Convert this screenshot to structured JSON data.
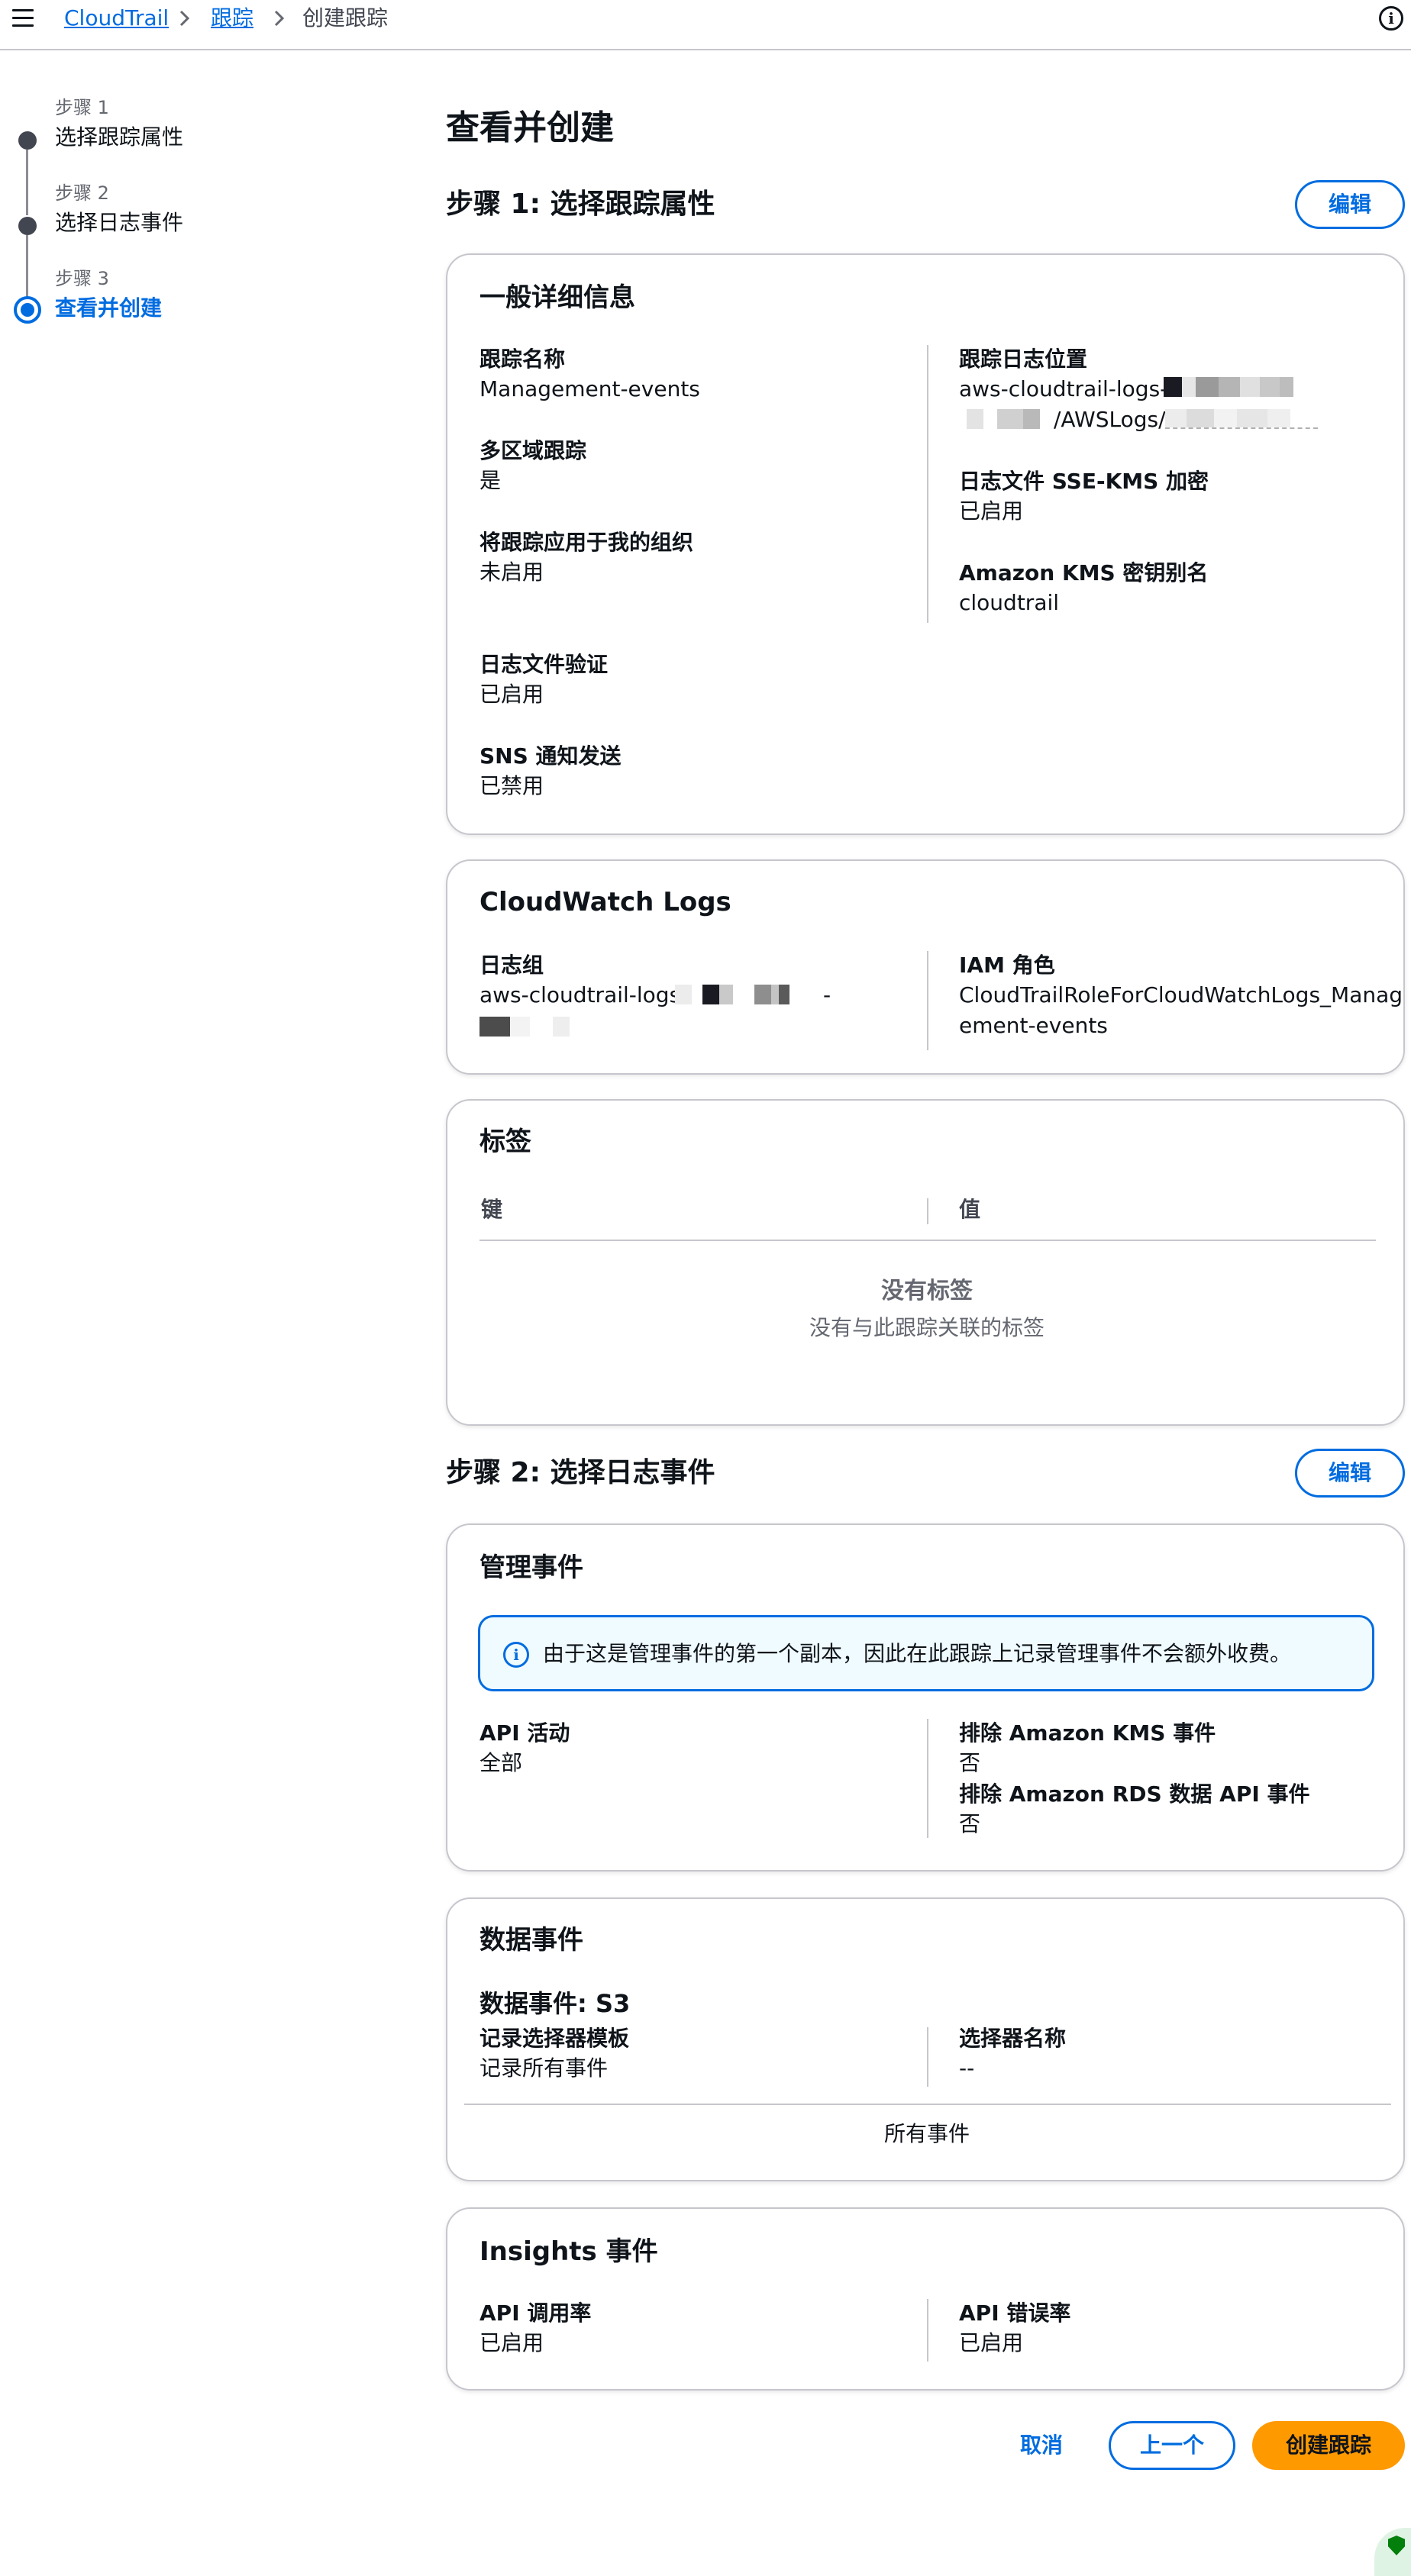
{
  "breadcrumb": {
    "items": [
      "CloudTrail",
      "跟踪"
    ],
    "current": "创建跟踪"
  },
  "steps": [
    {
      "num": "步骤 1",
      "name": "选择跟踪属性"
    },
    {
      "num": "步骤 2",
      "name": "选择日志事件"
    },
    {
      "num": "步骤 3",
      "name": "查看并创建"
    }
  ],
  "page_title": "查看并创建",
  "edit_label": "编辑",
  "step1": {
    "heading": "步骤 1: 选择跟踪属性",
    "general": {
      "title": "一般详细信息",
      "trail_name_label": "跟踪名称",
      "trail_name": "Management-events",
      "multi_region_label": "多区域跟踪",
      "multi_region": "是",
      "org_label": "将跟踪应用于我的组织",
      "org": "未启用",
      "log_location_label": "跟踪日志位置",
      "log_location_line1": "aws-cloudtrail-logs-",
      "log_location_line2": "/AWSLogs/",
      "sse_label": "日志文件 SSE-KMS 加密",
      "sse": "已启用",
      "kms_alias_label": "Amazon KMS 密钥别名",
      "kms_alias": "cloudtrail",
      "validation_label": "日志文件验证",
      "validation": "已启用",
      "sns_label": "SNS 通知发送",
      "sns": "已禁用"
    },
    "cloudwatch": {
      "title": "CloudWatch Logs",
      "log_group_label": "日志组",
      "log_group": "aws-cloudtrail-logs-",
      "log_group_suffix": "-",
      "iam_label": "IAM 角色",
      "iam_line1": "CloudTrailRoleForCloudWatchLogs_Manag",
      "iam_line2": "ement-events"
    },
    "tags": {
      "title": "标签",
      "col_key": "键",
      "col_value": "值",
      "empty_title": "没有标签",
      "empty_sub": "没有与此跟踪关联的标签"
    }
  },
  "step2": {
    "heading": "步骤 2: 选择日志事件",
    "management": {
      "title": "管理事件",
      "alert": "由于这是管理事件的第一个副本，因此在此跟踪上记录管理事件不会额外收费。",
      "api_label": "API 活动",
      "api": "全部",
      "kms_label": "排除 Amazon KMS 事件",
      "kms": "否",
      "rds_label": "排除 Amazon RDS 数据 API 事件",
      "rds": "否"
    },
    "data": {
      "title": "数据事件",
      "subtitle": "数据事件: S3",
      "template_label": "记录选择器模板",
      "template": "记录所有事件",
      "selector_label": "选择器名称",
      "selector": "--",
      "all_events": "所有事件"
    },
    "insights": {
      "title": "Insights 事件",
      "rate_label": "API 调用率",
      "rate": "已启用",
      "error_label": "API 错误率",
      "error": "已启用"
    }
  },
  "actions": {
    "cancel": "取消",
    "previous": "上一个",
    "create": "创建跟踪"
  },
  "colors": {
    "link": "#006ce0",
    "primary_button": "#ff9900",
    "border": "#c6c6cd",
    "alert_bg": "#f0fbff"
  }
}
